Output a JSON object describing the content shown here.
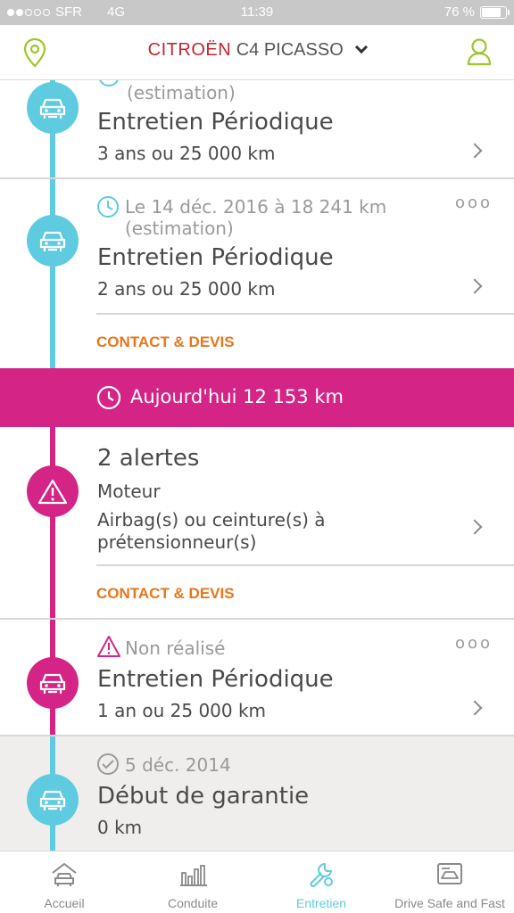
{
  "status_bar": {
    "carrier": "SFR",
    "network": "4G",
    "time": "11:39",
    "battery": "76 %",
    "battery_level": 0.76
  },
  "header": {
    "brand": "CITROËN",
    "model": "C4 PICASSO"
  },
  "timeline": {
    "item1": {
      "meta": "(estimation)",
      "title": "Entretien Périodique",
      "subtitle": "3 ans ou 25 000 km"
    },
    "item2": {
      "meta_line1": "Le 14 déc. 2016 à 18 241 km",
      "meta_line2": "(estimation)",
      "title": "Entretien Périodique",
      "subtitle": "2 ans ou 25 000 km",
      "link": "CONTACT & DEVIS",
      "more": "ooo"
    },
    "today": {
      "label": "Aujourd'hui 12 153 km"
    },
    "alerts": {
      "title": "2 alertes",
      "line1": "Moteur",
      "line2a": "Airbag(s) ou ceinture(s) à",
      "line2b": "prétensionneur(s)",
      "link": "CONTACT & DEVIS"
    },
    "item3": {
      "meta": "Non réalisé",
      "title": "Entretien Périodique",
      "subtitle": "1 an ou 25 000 km",
      "more": "ooo"
    },
    "item4": {
      "meta": "5 déc. 2014",
      "title": "Début de garantie",
      "subtitle": "0 km"
    }
  },
  "tabs": [
    {
      "label": "Accueil",
      "icon": "car-home-icon"
    },
    {
      "label": "Conduite",
      "icon": "bar-chart-icon"
    },
    {
      "label": "Entretien",
      "icon": "wrench-icon",
      "active": true
    },
    {
      "label": "Drive Safe and Fast",
      "icon": "card-icon"
    }
  ],
  "colors": {
    "accent_blue": "#5fcbe0",
    "accent_pink": "#d42486",
    "link_orange": "#e8761b",
    "brand_red": "#c3272f"
  }
}
